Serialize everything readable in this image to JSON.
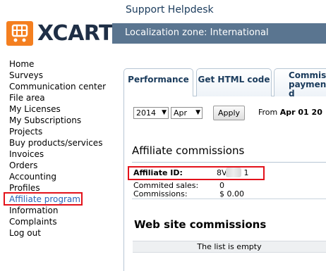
{
  "brand": {
    "wordmark": "XCART",
    "accent": "#f47f20",
    "dark": "#1f2f46"
  },
  "header": {
    "title": "Support Helpdesk",
    "zone": "Localization zone: International",
    "zone_bar_color": "#5a7590"
  },
  "sidebar": {
    "items": [
      {
        "label": "Home"
      },
      {
        "label": "Surveys"
      },
      {
        "label": "Communication center"
      },
      {
        "label": "File area"
      },
      {
        "label": "My Licenses"
      },
      {
        "label": "My Subscriptions"
      },
      {
        "label": "Projects"
      },
      {
        "label": "Buy products/services"
      },
      {
        "label": "Invoices"
      },
      {
        "label": "Orders"
      },
      {
        "label": "Accounting"
      },
      {
        "label": "Profiles"
      },
      {
        "label": "Affiliate program"
      },
      {
        "label": "Information"
      },
      {
        "label": "Complaints"
      },
      {
        "label": "Log out"
      }
    ],
    "active_index": 12
  },
  "tabs": [
    {
      "label": "Performance"
    },
    {
      "label": "Get HTML code"
    },
    {
      "label_line1": "Commiss",
      "label_line2": "payment d"
    }
  ],
  "filters": {
    "year": "2014",
    "month": "Apr",
    "apply_label": "Apply",
    "range_prefix": "From",
    "range_start": "Apr 01 20"
  },
  "affiliate": {
    "section_title": "Affiliate commissions",
    "id_label": "Affiliate ID:",
    "id_value_start": "8V",
    "id_value_end": "1",
    "committed_label": "Commited sales:",
    "committed_value": "0",
    "commissions_label": "Commissions:",
    "commissions_value": "$ 0.00"
  },
  "web": {
    "section_title": "Web site commissions",
    "empty_text": "The list is empty"
  },
  "highlight_color": "#e3121b"
}
